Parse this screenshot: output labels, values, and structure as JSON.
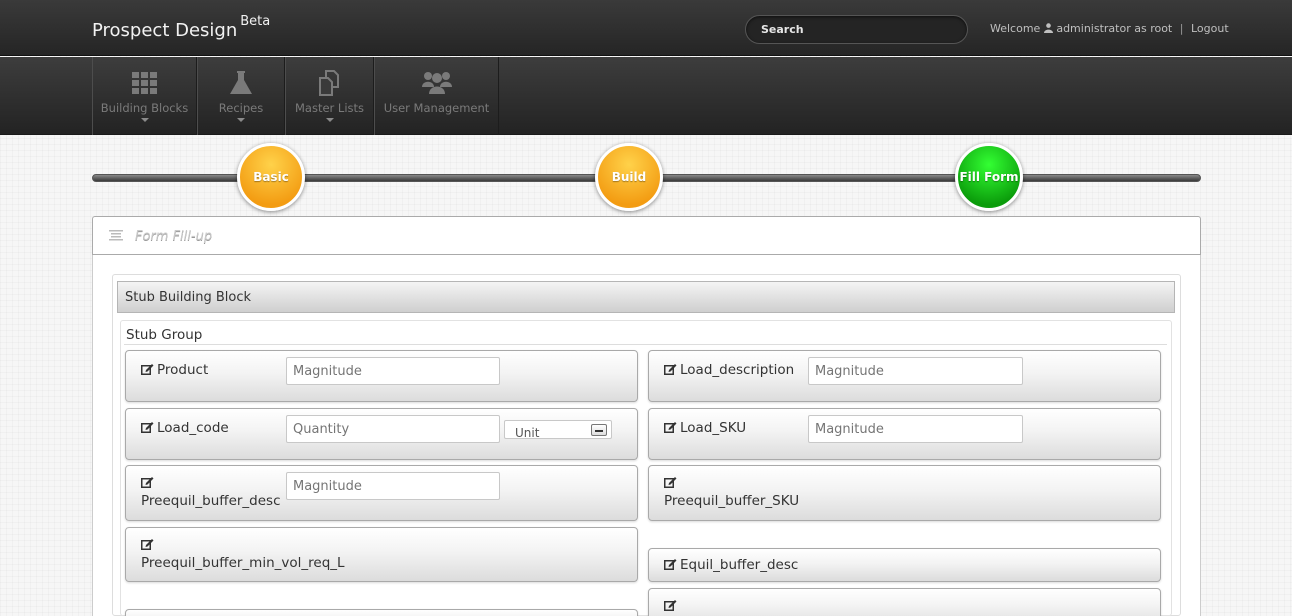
{
  "app": {
    "title": "Prospect Design",
    "badge": "Beta"
  },
  "search": {
    "placeholder": "Search"
  },
  "user": {
    "welcome": "Welcome",
    "name": "administrator as root",
    "separator": "|",
    "logout": "Logout"
  },
  "nav": {
    "items": [
      {
        "label": "Building Blocks",
        "icon": "grid-icon"
      },
      {
        "label": "Recipes",
        "icon": "flask-icon"
      },
      {
        "label": "Master Lists",
        "icon": "documents-icon"
      },
      {
        "label": "User Management",
        "icon": "users-icon"
      }
    ]
  },
  "wizard": {
    "steps": [
      {
        "label": "Basic",
        "state": "complete",
        "color": "#f39c12"
      },
      {
        "label": "Build",
        "state": "complete",
        "color": "#f39c12"
      },
      {
        "label": "Fill Form",
        "state": "active",
        "color": "#0b9c0b"
      }
    ]
  },
  "panel": {
    "title": "Form Fill-up",
    "icon": "list-icon"
  },
  "block": {
    "title": "Stub Building Block"
  },
  "group": {
    "title": "Stub Group"
  },
  "fields": {
    "product": {
      "label": "Product",
      "placeholder": "Magnitude"
    },
    "load_description": {
      "label": "Load_description",
      "placeholder": "Magnitude"
    },
    "load_code": {
      "label": "Load_code",
      "placeholder": "Quantity",
      "unit_placeholder": "Unit"
    },
    "load_sku": {
      "label": "Load_SKU",
      "placeholder": "Magnitude"
    },
    "preequil_buffer_desc": {
      "label": "Preequil_buffer_desc",
      "placeholder": "Magnitude"
    },
    "preequil_buffer_sku": {
      "label": "Preequil_buffer_SKU"
    },
    "preequil_buffer_min_vol_req_l": {
      "label": "Preequil_buffer_min_vol_req_L"
    },
    "equil_buffer_desc": {
      "label": "Equil_buffer_desc"
    }
  }
}
